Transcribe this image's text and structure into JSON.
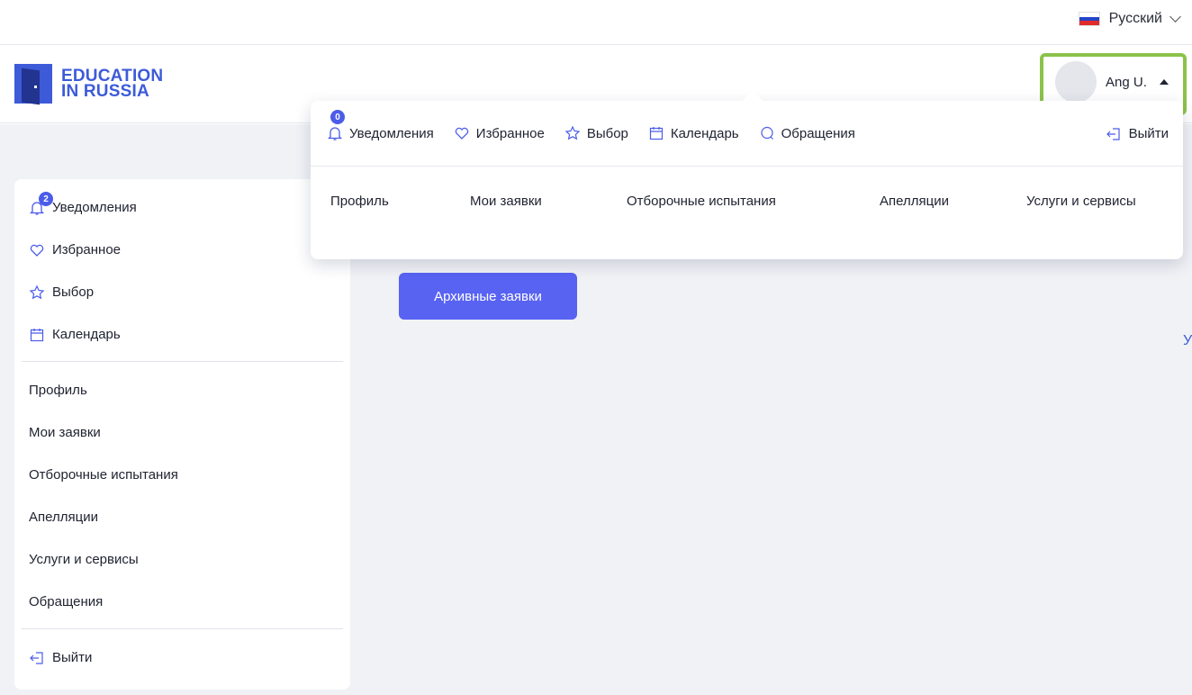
{
  "language": {
    "label": "Русский",
    "flag": "russia-flag"
  },
  "logo": {
    "line1": "EDUCATION",
    "line2": "IN RUSSIA",
    "color": "#3d5bd8"
  },
  "user": {
    "name": "Ang U."
  },
  "highlight_color": "#8bc34a",
  "sidebar": {
    "top_items": [
      {
        "label": "Уведомления",
        "icon": "bell-icon",
        "badge": "2"
      },
      {
        "label": "Избранное",
        "icon": "heart-icon"
      },
      {
        "label": "Выбор",
        "icon": "star-icon"
      },
      {
        "label": "Календарь",
        "icon": "calendar-icon"
      }
    ],
    "nav_items": [
      {
        "label": "Профиль"
      },
      {
        "label": "Мои заявки"
      },
      {
        "label": "Отборочные испытания"
      },
      {
        "label": "Апелляции"
      },
      {
        "label": "Услуги и сервисы"
      },
      {
        "label": "Обращения"
      }
    ],
    "logout": {
      "label": "Выйти",
      "icon": "logout-icon"
    }
  },
  "main": {
    "archived_button": "Архивные заявки",
    "partial_letter": "У",
    "accent_color": "#5863f2"
  },
  "dropdown": {
    "top_items": [
      {
        "label": "Уведомления",
        "icon": "bell-icon",
        "badge": "0"
      },
      {
        "label": "Избранное",
        "icon": "heart-icon"
      },
      {
        "label": "Выбор",
        "icon": "star-icon"
      },
      {
        "label": "Календарь",
        "icon": "calendar-icon"
      },
      {
        "label": "Обращения",
        "icon": "chat-icon"
      }
    ],
    "logout": {
      "label": "Выйти",
      "icon": "logout-icon"
    },
    "bottom_items": [
      {
        "label": "Профиль"
      },
      {
        "label": "Мои заявки"
      },
      {
        "label": "Отборочные испытания"
      },
      {
        "label": "Апелляции"
      },
      {
        "label": "Услуги и сервисы"
      }
    ]
  }
}
